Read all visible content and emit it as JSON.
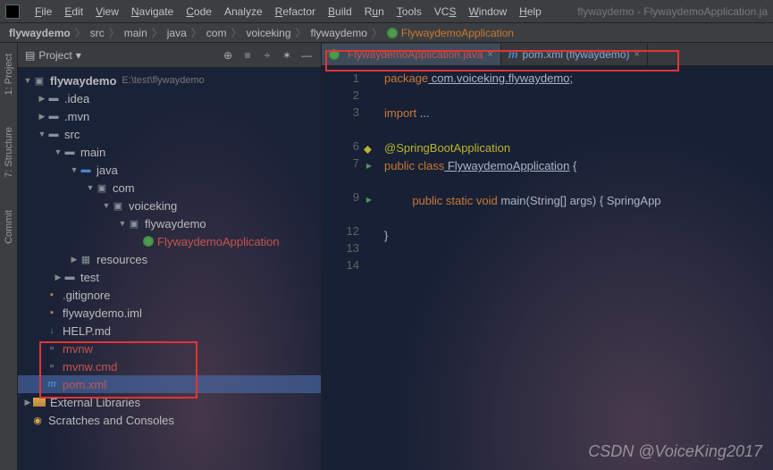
{
  "window": {
    "title": "flywaydemo - FlywaydemoApplication.ja"
  },
  "menu": {
    "file": "File",
    "edit": "Edit",
    "view": "View",
    "navigate": "Navigate",
    "code": "Code",
    "analyze": "Analyze",
    "refactor": "Refactor",
    "build": "Build",
    "run": "Run",
    "tools": "Tools",
    "vcs": "VCS",
    "window": "Window",
    "help": "Help"
  },
  "breadcrumb": {
    "items": [
      "flywaydemo",
      "src",
      "main",
      "java",
      "com",
      "voiceking",
      "flywaydemo"
    ],
    "current": "FlywaydemoApplication"
  },
  "left_gutter": {
    "project": "1: Project",
    "structure": "7: Structure",
    "commit": "Commit"
  },
  "project_panel": {
    "title": "Project",
    "root_name": "flywaydemo",
    "root_path": "E:\\test\\flywaydemo",
    "tree": {
      "idea": ".idea",
      "mvn": ".mvn",
      "src": "src",
      "main": "main",
      "java": "java",
      "com": "com",
      "voiceking": "voiceking",
      "flywaydemo_pkg": "flywaydemo",
      "app_class": "FlywaydemoApplication",
      "resources": "resources",
      "test": "test",
      "gitignore": ".gitignore",
      "iml": "flywaydemo.iml",
      "help": "HELP.md",
      "mvnw": "mvnw",
      "mvnw_cmd": "mvnw.cmd",
      "pom": "pom.xml",
      "ext_libs": "External Libraries",
      "scratches": "Scratches and Consoles"
    }
  },
  "editor": {
    "tabs": [
      {
        "label": "FlywaydemoApplication.java",
        "active": true,
        "kind": "spring"
      },
      {
        "label": "pom.xml (flywaydemo)",
        "active": false,
        "kind": "maven"
      }
    ],
    "line_numbers": [
      "1",
      "2",
      "3",
      "",
      "6",
      "7",
      "",
      "9",
      "",
      "12",
      "13",
      "14"
    ],
    "code": {
      "l1_kw": "package",
      "l1_rest": " com.voiceking.flywaydemo;",
      "l3_kw": "import",
      "l3_rest": " ...",
      "l6_ann": "@SpringBootApplication",
      "l7_pub": "public",
      "l7_cls": " class",
      "l7_name": " FlywaydemoApplication",
      "l7_brace": " {",
      "l9_pub": "public",
      "l9_stat": " static",
      "l9_void": " void",
      "l9_main": " main",
      "l9_args": "(String[] args) { SpringApp",
      "l13_close": "}"
    }
  },
  "watermark": "CSDN @VoiceKing2017"
}
